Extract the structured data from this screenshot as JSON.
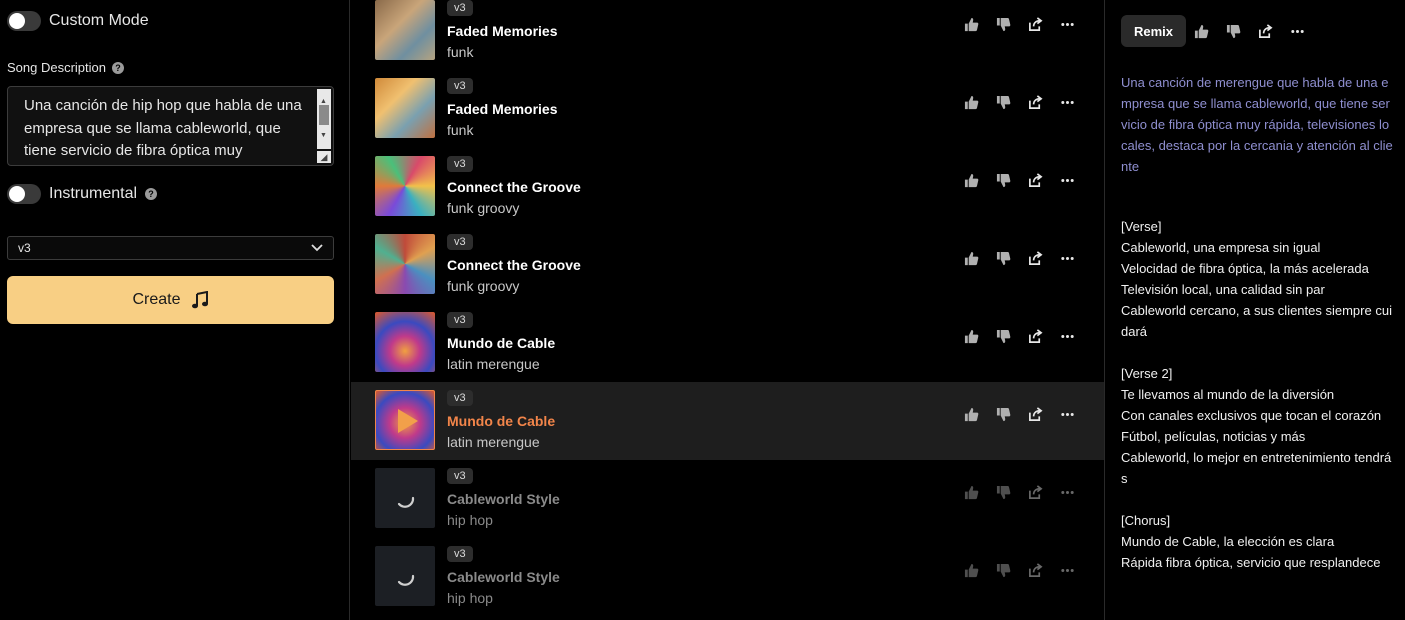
{
  "left": {
    "custom_mode_label": "Custom Mode",
    "song_description_label": "Song Description",
    "song_description_value": "Una canción de hip hop que habla de una empresa que se llama cableworld, que tiene servicio de fibra óptica muy",
    "instrumental_label": "Instrumental",
    "version_value": "v3",
    "create_label": "Create"
  },
  "songs": [
    {
      "version": "v3",
      "title": "Faded Memories",
      "genre": "funk",
      "state": "ready"
    },
    {
      "version": "v3",
      "title": "Faded Memories",
      "genre": "funk",
      "state": "ready"
    },
    {
      "version": "v3",
      "title": "Connect the Groove",
      "genre": "funk groovy",
      "state": "ready"
    },
    {
      "version": "v3",
      "title": "Connect the Groove",
      "genre": "funk groovy",
      "state": "ready"
    },
    {
      "version": "v3",
      "title": "Mundo de Cable",
      "genre": "latin merengue",
      "state": "ready"
    },
    {
      "version": "v3",
      "title": "Mundo de Cable",
      "genre": "latin merengue",
      "state": "playing"
    },
    {
      "version": "v3",
      "title": "Cableworld Style",
      "genre": "hip hop",
      "state": "pending"
    },
    {
      "version": "v3",
      "title": "Cableworld Style",
      "genre": "hip hop",
      "state": "pending"
    }
  ],
  "right": {
    "remix_label": "Remix",
    "prompt": "Una canción de merengue que habla de una empresa que se llama cableworld, que tiene servicio de fibra óptica muy rápida, televisiones locales, destaca por la cercania y atención al cliente",
    "lyrics": [
      "[Verse]",
      "Cableworld, una empresa sin igual",
      "Velocidad de fibra óptica, la más acelerada",
      "Televisión local, una calidad sin par",
      "Cableworld cercano, a sus clientes siempre cuidará",
      "",
      "[Verse 2]",
      "Te llevamos al mundo de la diversión",
      "Con canales exclusivos que tocan el corazón",
      "Fútbol, películas, noticias y más",
      "Cableworld, lo mejor en entretenimiento tendrás",
      "",
      "[Chorus]",
      "Mundo de Cable, la elección es clara",
      "Rápida fibra óptica, servicio que resplandece"
    ]
  },
  "colors": {
    "accent": "#f2854a",
    "create_button": "#f8cf84",
    "prompt_text": "#8f8fd0"
  }
}
